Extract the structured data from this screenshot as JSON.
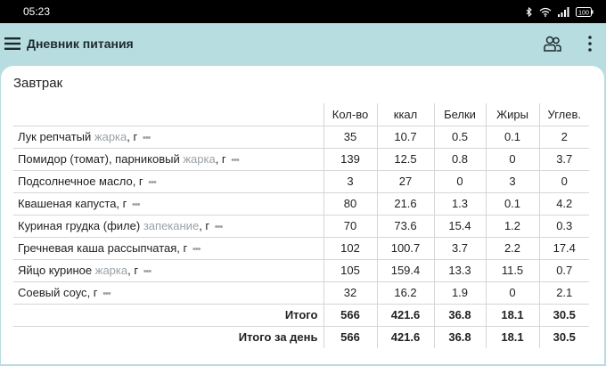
{
  "status_bar": {
    "time": "05:23",
    "battery": "100"
  },
  "app_bar": {
    "title": "Дневник питания"
  },
  "meal": {
    "title": "Завтрак",
    "columns": [
      "Кол-во",
      "ккал",
      "Белки",
      "Жиры",
      "Углев."
    ],
    "rows": [
      {
        "name": "Лук репчатый",
        "method": "жарка",
        "unit": ", г",
        "qty": "35",
        "kcal": "10.7",
        "protein": "0.5",
        "fat": "0.1",
        "carbs": "2"
      },
      {
        "name": "Помидор (томат), парниковый",
        "method": "жарка",
        "unit": ", г",
        "qty": "139",
        "kcal": "12.5",
        "protein": "0.8",
        "fat": "0",
        "carbs": "3.7"
      },
      {
        "name": "Подсолнечное масло",
        "method": "",
        "unit": ", г",
        "qty": "3",
        "kcal": "27",
        "protein": "0",
        "fat": "3",
        "carbs": "0"
      },
      {
        "name": "Квашеная капуста",
        "method": "",
        "unit": ", г",
        "qty": "80",
        "kcal": "21.6",
        "protein": "1.3",
        "fat": "0.1",
        "carbs": "4.2"
      },
      {
        "name": "Куриная грудка (филе)",
        "method": "запекание",
        "unit": ", г",
        "qty": "70",
        "kcal": "73.6",
        "protein": "15.4",
        "fat": "1.2",
        "carbs": "0.3"
      },
      {
        "name": "Гречневая каша рассыпчатая",
        "method": "",
        "unit": ", г",
        "qty": "102",
        "kcal": "100.7",
        "protein": "3.7",
        "fat": "2.2",
        "carbs": "17.4"
      },
      {
        "name": "Яйцо куриное",
        "method": "жарка",
        "unit": ", г",
        "qty": "105",
        "kcal": "159.4",
        "protein": "13.3",
        "fat": "11.5",
        "carbs": "0.7"
      },
      {
        "name": "Соевый соус",
        "method": "",
        "unit": ", г",
        "qty": "32",
        "kcal": "16.2",
        "protein": "1.9",
        "fat": "0",
        "carbs": "2.1"
      }
    ],
    "total": {
      "label": "Итого",
      "qty": "566",
      "kcal": "421.6",
      "protein": "36.8",
      "fat": "18.1",
      "carbs": "30.5"
    },
    "day_total": {
      "label": "Итого за день",
      "qty": "566",
      "kcal": "421.6",
      "protein": "36.8",
      "fat": "18.1",
      "carbs": "30.5"
    }
  },
  "icons": {
    "menu": "hamburger-menu-icon",
    "people": "people-icon",
    "more": "more-vertical-icon",
    "row_options": "more-horizontal-icon"
  },
  "colors": {
    "app_bar_bg": "#b8dde0",
    "method_text": "#9aa2a8"
  }
}
